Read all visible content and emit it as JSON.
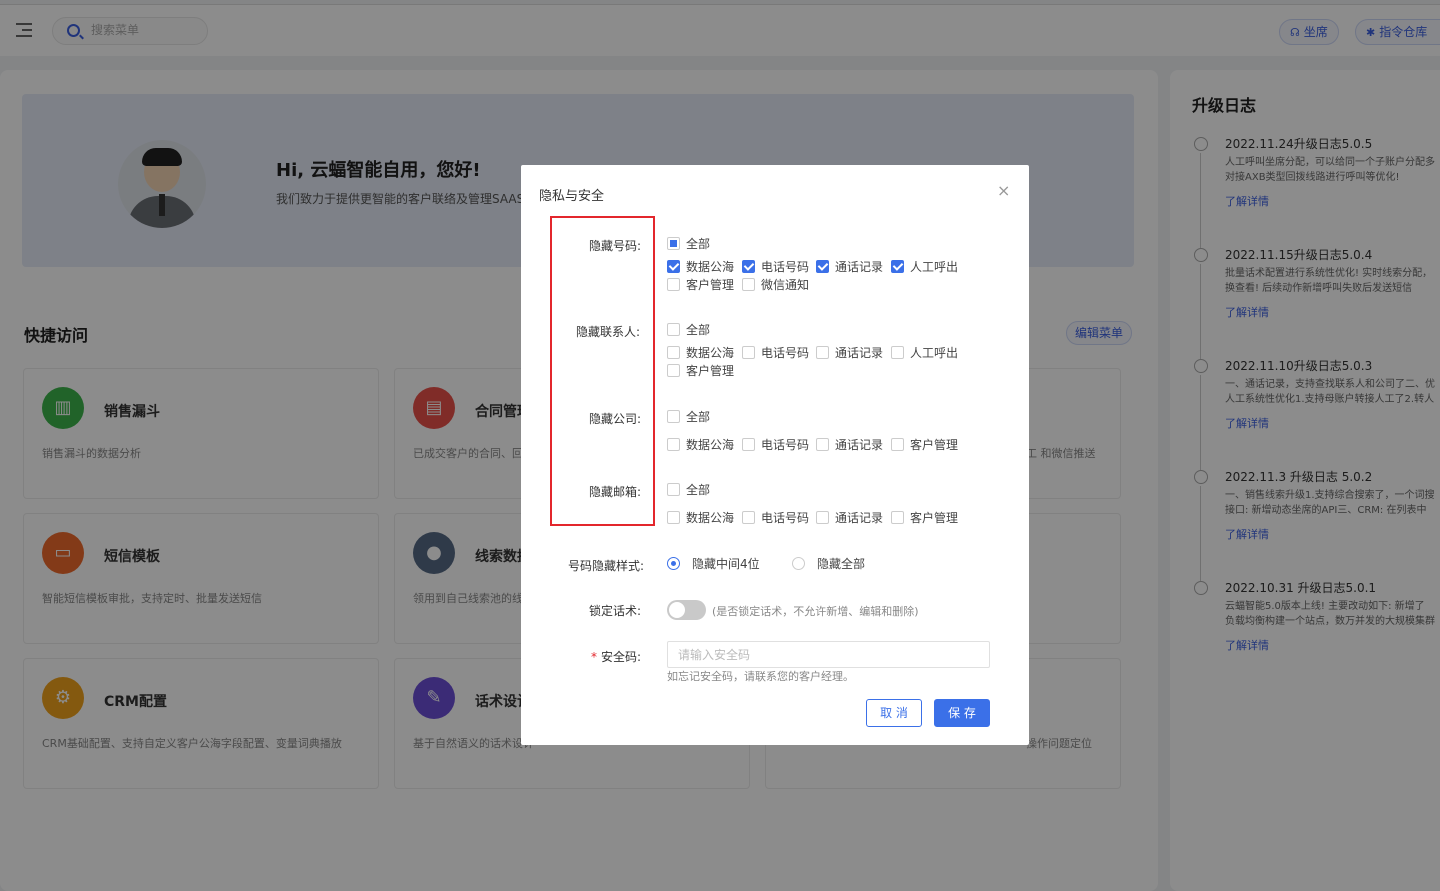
{
  "topbar": {
    "search_placeholder": "搜索菜单",
    "seat_button": "坐席",
    "command_button": "指令仓库"
  },
  "banner": {
    "greeting": "Hi, 云蝠智能自用，您好!",
    "subtitle": "我们致力于提供更智能的客户联络及管理SAAS"
  },
  "quick_access": {
    "title": "快捷访问",
    "edit_button": "编辑菜单",
    "cards": [
      {
        "title": "销售漏斗",
        "desc": "销售漏斗的数据分析",
        "icon": "bar-chart-icon",
        "color": "#3cb44b"
      },
      {
        "title": "合同管理",
        "desc": "已成交客户的合同、回款",
        "icon": "clipboard-icon",
        "color": "#e9504a"
      },
      {
        "title": "短信模板",
        "desc": "智能短信模板审批，支持定时、批量发送短信",
        "icon": "message-icon",
        "color": "#ef6a2c"
      },
      {
        "title": "线索数据",
        "desc": "领用到自己线索池的线索",
        "icon": "user-search-icon",
        "color": "#566a86"
      },
      {
        "title": "CRM配置",
        "desc": "CRM基础配置、支持自定义客户公海字段配置、变量词典播放",
        "icon": "user-gear-icon",
        "color": "#f0a21c"
      },
      {
        "title": "话术设计",
        "desc": "基于自然语义的话术设计",
        "icon": "pen-icon",
        "color": "#6c4fd8"
      }
    ],
    "edge_descs": [
      "工 和微信推送",
      "操作问题定位"
    ]
  },
  "upgrade_log": {
    "title": "升级日志",
    "more_label": "了解详情",
    "entries": [
      {
        "title": "2022.11.24升级日志5.0.5",
        "line1": "人工呼叫坐席分配，可以给同一个子账户分配多",
        "line2": "对接AXB类型回拨线路进行呼叫等优化!"
      },
      {
        "title": "2022.11.15升级日志5.0.4",
        "line1": "批量话术配置进行系统性优化! 实时线索分配，",
        "line2": "换查看! 后续动作新增呼叫失败后发送短信"
      },
      {
        "title": "2022.11.10升级日志5.0.3",
        "line1": "一、通话记录，支持查找联系人和公司了二、优",
        "line2": "人工系统性优化1.支持母账户转接人工了2.转人"
      },
      {
        "title": "2022.11.3 升级日志 5.0.2",
        "line1": "一、销售线索升级1.支持综合搜索了，一个词搜",
        "line2": "接口: 新增动态坐席的API三、CRM: 在列表中"
      },
      {
        "title": "2022.10.31 升级日志5.0.1",
        "line1": "云蝠智能5.0版本上线! 主要改动如下: 新增了",
        "line2": "负载均衡构建一个站点，数万并发的大规模集群"
      }
    ]
  },
  "dialog": {
    "title": "隐私与安全",
    "close_symbol": "×",
    "all_label": "全部",
    "opt_public": "数据公海",
    "opt_phone": "电话号码",
    "opt_calls": "通话记录",
    "opt_manual": "人工呼出",
    "opt_customer": "客户管理",
    "opt_wechat": "微信通知",
    "hide_number_label": "隐藏号码:",
    "hide_contact_label": "隐藏联系人:",
    "hide_company_label": "隐藏公司:",
    "hide_email_label": "隐藏邮箱:",
    "style_label": "号码隐藏样式:",
    "style_option1": "隐藏中间4位",
    "style_option2": "隐藏全部",
    "lock_label": "锁定话术:",
    "lock_hint": "(是否锁定话术，不允许新增、编辑和删除)",
    "required_mark": "*",
    "safe_label": "安全码:",
    "safe_placeholder": "请输入安全码",
    "safe_hint": "如忘记安全码，请联系您的客户经理。",
    "cancel_label": "取 消",
    "save_label": "保 存"
  }
}
